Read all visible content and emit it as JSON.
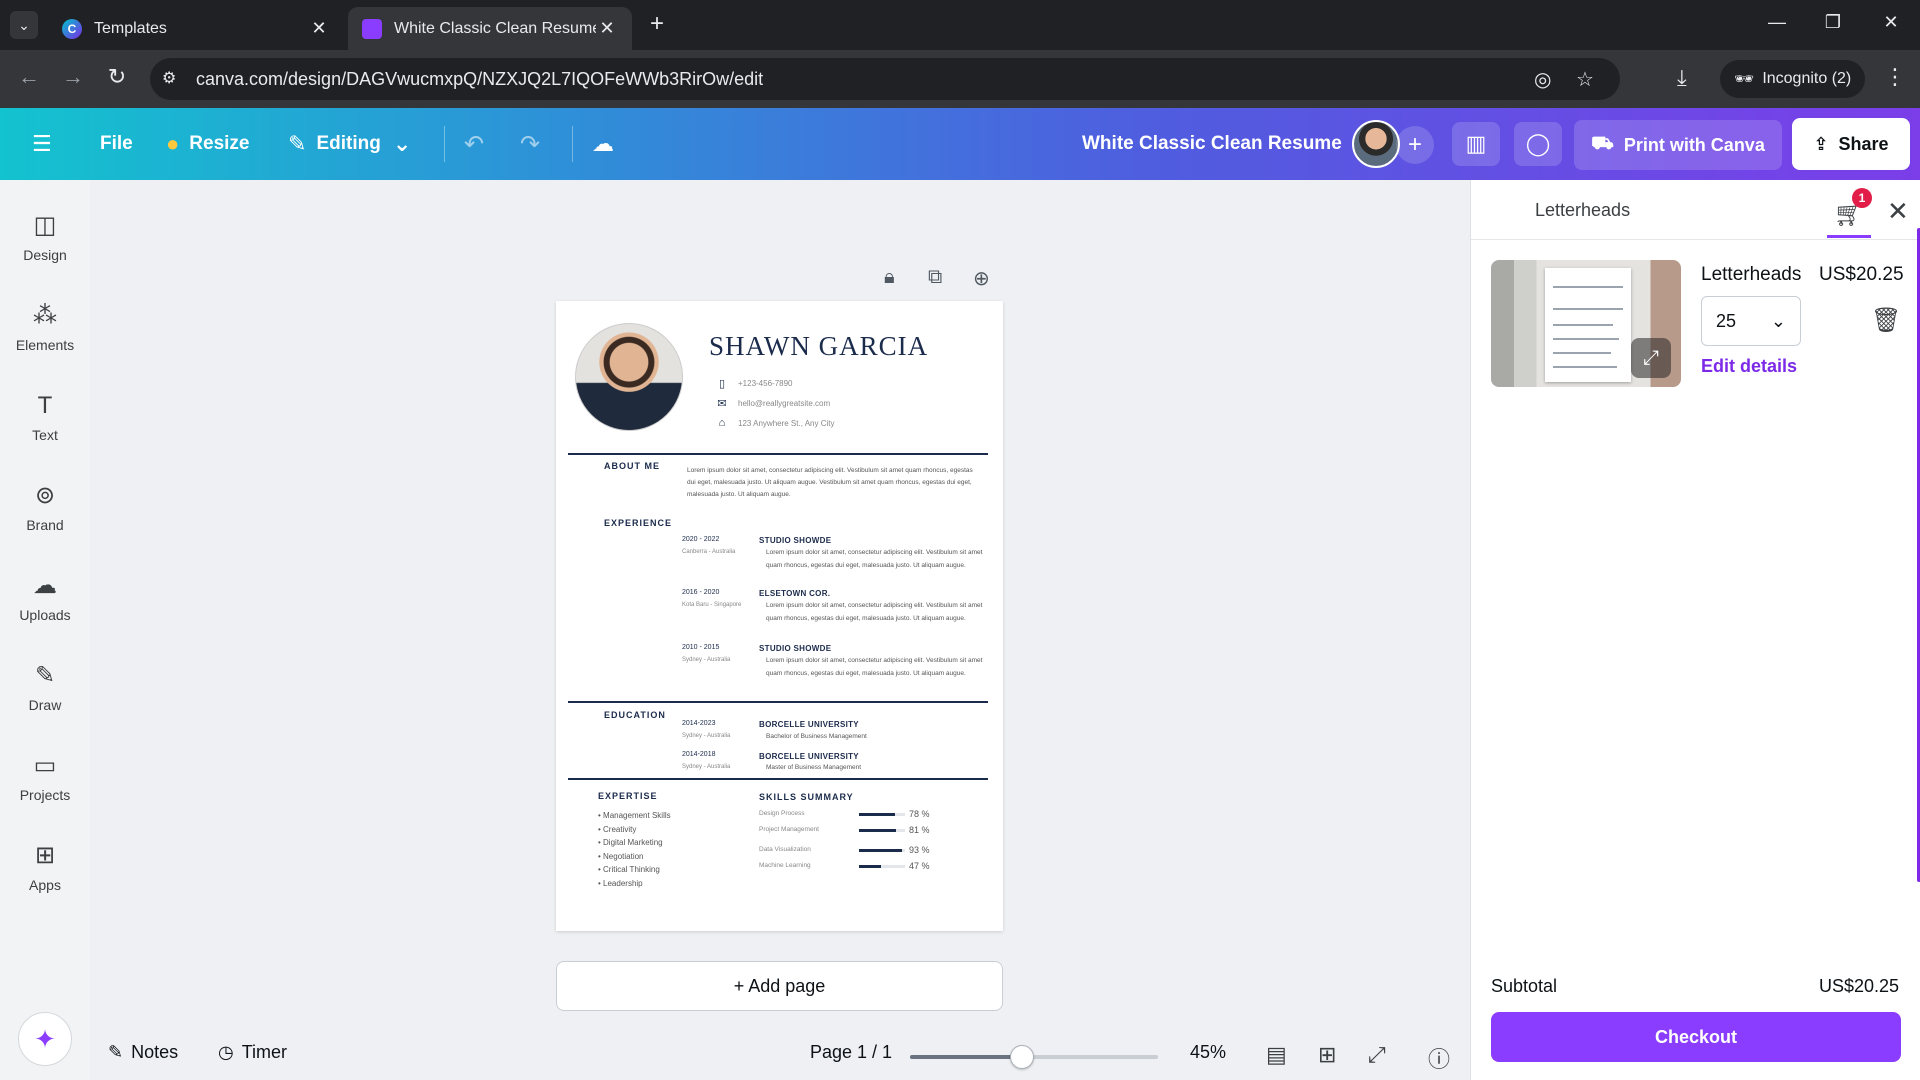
{
  "browser": {
    "tabs": [
      {
        "title": "Templates",
        "favicon": "canva-icon"
      },
      {
        "title": "White Classic Clean Resume - A",
        "favicon": "canva-doc-icon"
      }
    ],
    "url": "canva.com/design/DAGVwucmxpQ/NZXJQ2L7IQOFeWWb3RirOw/edit",
    "incognito_label": "Incognito (2)"
  },
  "toolbar": {
    "file": "File",
    "resize": "Resize",
    "editing": "Editing",
    "doc_title": "White Classic Clean Resume",
    "print": "Print with Canva",
    "share": "Share"
  },
  "rail": [
    {
      "label": "Design",
      "icon": "design-icon"
    },
    {
      "label": "Elements",
      "icon": "elements-icon"
    },
    {
      "label": "Text",
      "icon": "text-icon"
    },
    {
      "label": "Brand",
      "icon": "brand-icon"
    },
    {
      "label": "Uploads",
      "icon": "uploads-icon"
    },
    {
      "label": "Draw",
      "icon": "draw-icon"
    },
    {
      "label": "Projects",
      "icon": "projects-icon"
    },
    {
      "label": "Apps",
      "icon": "apps-icon"
    }
  ],
  "resume": {
    "name": "SHAWN GARCIA",
    "phone": "+123-456-7890",
    "email": "hello@reallygreatsite.com",
    "address": "123 Anywhere St., Any City",
    "about_heading": "ABOUT ME",
    "about_text": "Lorem ipsum dolor sit amet, consectetur adipiscing elit. Vestibulum sit amet quam rhoncus, egestas dui eget, malesuada justo. Ut aliquam augue. Vestibulum sit amet quam rhoncus, egestas dui eget, malesuada justo. Ut aliquam augue.",
    "experience_heading": "EXPERIENCE",
    "jobs": [
      {
        "date": "2020 - 2022",
        "location": "Canberra - Australia",
        "company": "STUDIO SHOWDE",
        "desc": "Lorem ipsum dolor sit amet, consectetur adipiscing elit. Vestibulum sit amet quam rhoncus, egestas dui eget, malesuada justo. Ut aliquam augue."
      },
      {
        "date": "2016 - 2020",
        "location": "Kota Baru - Singapore",
        "company": "ELSETOWN COR.",
        "desc": "Lorem ipsum dolor sit amet, consectetur adipiscing elit. Vestibulum sit amet quam rhoncus, egestas dui eget, malesuada justo. Ut aliquam augue."
      },
      {
        "date": "2010 - 2015",
        "location": "Sydney - Australia",
        "company": "STUDIO SHOWDE",
        "desc": "Lorem ipsum dolor sit amet, consectetur adipiscing elit. Vestibulum sit amet quam rhoncus, egestas dui eget, malesuada justo. Ut aliquam augue."
      }
    ],
    "education_heading": "EDUCATION",
    "education": [
      {
        "date": "2014-2023",
        "location": "Sydney - Australia",
        "school": "BORCELLE UNIVERSITY",
        "degree": "Bachelor of Business Management"
      },
      {
        "date": "2014-2018",
        "location": "Sydney - Australia",
        "school": "BORCELLE UNIVERSITY",
        "degree": "Master of Business Management"
      }
    ],
    "expertise_heading": "EXPERTISE",
    "expertise": [
      "Management Skills",
      "Creativity",
      "Digital Marketing",
      "Negotiation",
      "Critical Thinking",
      "Leadership"
    ],
    "skills_heading": "SKILLS SUMMARY",
    "skills": [
      {
        "name": "Design Process",
        "pct": "78 %",
        "level": 0.78
      },
      {
        "name": "Project Management",
        "pct": "81 %",
        "level": 0.81
      },
      {
        "name": "Data Visualization",
        "pct": "93 %",
        "level": 0.93
      },
      {
        "name": "Machine Learning",
        "pct": "47 %",
        "level": 0.47
      }
    ]
  },
  "canvas": {
    "add_page": "+ Add page"
  },
  "footer": {
    "notes": "Notes",
    "timer": "Timer",
    "page": "Page 1 / 1",
    "zoom": "45%",
    "zoom_level": 0.45
  },
  "panel": {
    "tab": "Letterheads",
    "cart_count": "1",
    "product": "Letterheads",
    "price": "US$20.25",
    "quantity": "25",
    "edit_details": "Edit details",
    "subtotal_label": "Subtotal",
    "subtotal_value": "US$20.25",
    "checkout": "Checkout"
  },
  "colors": {
    "brand_purple": "#8b3dff",
    "resume_navy": "#1b2b4b"
  }
}
